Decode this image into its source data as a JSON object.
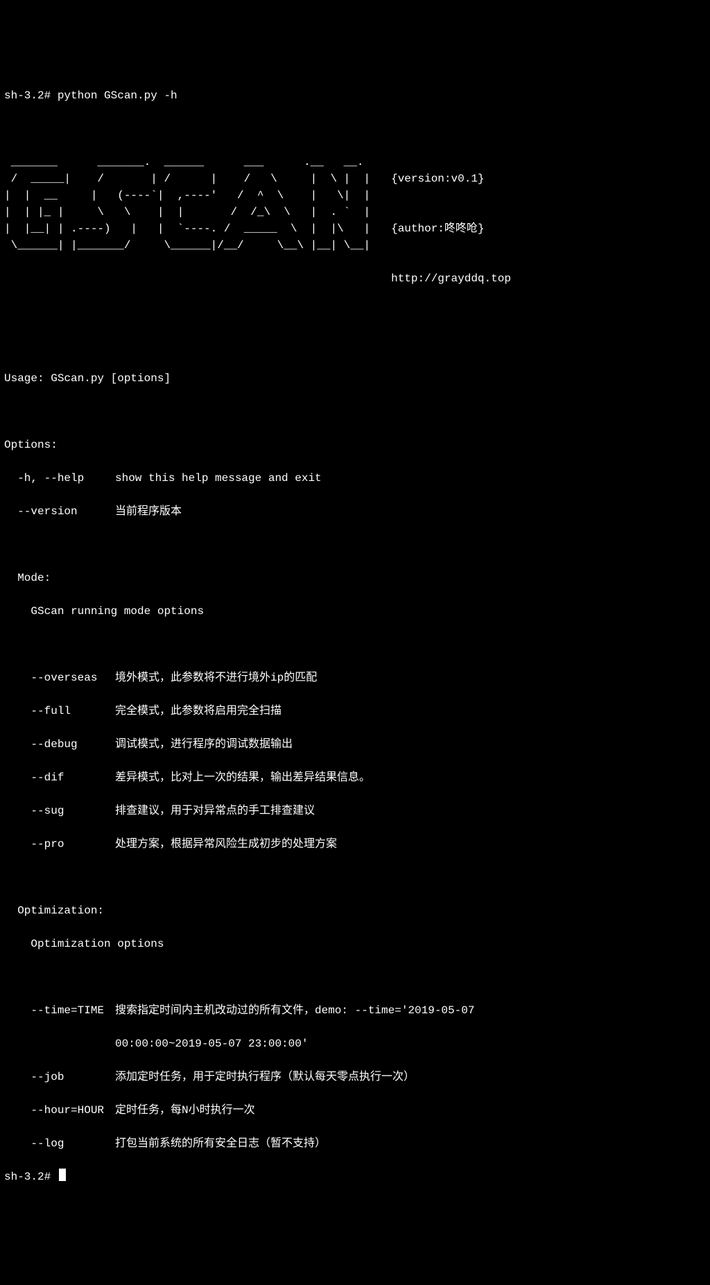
{
  "prompt1": "sh-3.2# ",
  "command": "python GScan.py -h",
  "ascii_art": " _______      _______.  ______      ___      .__   __. \n /  _____|    /       | /      |    /   \\     |  \\ |  |\n|  |  __     |   (----`|  ,----'   /  ^  \\    |   \\|  |\n|  | |_ |     \\   \\    |  |       /  /_\\  \\   |  . `  |\n|  |__| | .----)   |   |  `----. /  _____  \\  |  |\\   |\n \\______| |_______/     \\______|/__/     \\__\\ |__| \\__|",
  "meta_version": "{version:v0.1}",
  "meta_author": "{author:咚咚呛}",
  "meta_url": "http://grayddq.top",
  "usage": "Usage: GScan.py [options]",
  "options_header": "Options:",
  "opt_help_flag": "  -h, --help",
  "opt_help_desc": "show this help message and exit",
  "opt_version_flag": "  --version",
  "opt_version_desc": "当前程序版本",
  "mode_header": "  Mode:",
  "mode_sub": "    GScan running mode options",
  "opt_overseas_flag": "    --overseas",
  "opt_overseas_desc": "境外模式，此参数将不进行境外ip的匹配",
  "opt_full_flag": "    --full",
  "opt_full_desc": "完全模式，此参数将启用完全扫描",
  "opt_debug_flag": "    --debug",
  "opt_debug_desc": "调试模式，进行程序的调试数据输出",
  "opt_dif_flag": "    --dif",
  "opt_dif_desc": "差异模式，比对上一次的结果，输出差异结果信息。",
  "opt_sug_flag": "    --sug",
  "opt_sug_desc": "排查建议，用于对异常点的手工排查建议",
  "opt_pro_flag": "    --pro",
  "opt_pro_desc": "处理方案，根据异常风险生成初步的处理方案",
  "optim_header": "  Optimization:",
  "optim_sub": "    Optimization options",
  "opt_time_flag": "    --time=TIME",
  "opt_time_desc1": "搜索指定时间内主机改动过的所有文件，demo: --time='2019-05-07",
  "opt_time_desc2": "00:00:00~2019-05-07 23:00:00'",
  "opt_job_flag": "    --job",
  "opt_job_desc": "添加定时任务，用于定时执行程序（默认每天零点执行一次）",
  "opt_hour_flag": "    --hour=HOUR",
  "opt_hour_desc": "定时任务，每N小时执行一次",
  "opt_log_flag": "    --log",
  "opt_log_desc": "打包当前系统的所有安全日志（暂不支持）",
  "prompt2": "sh-3.2# "
}
